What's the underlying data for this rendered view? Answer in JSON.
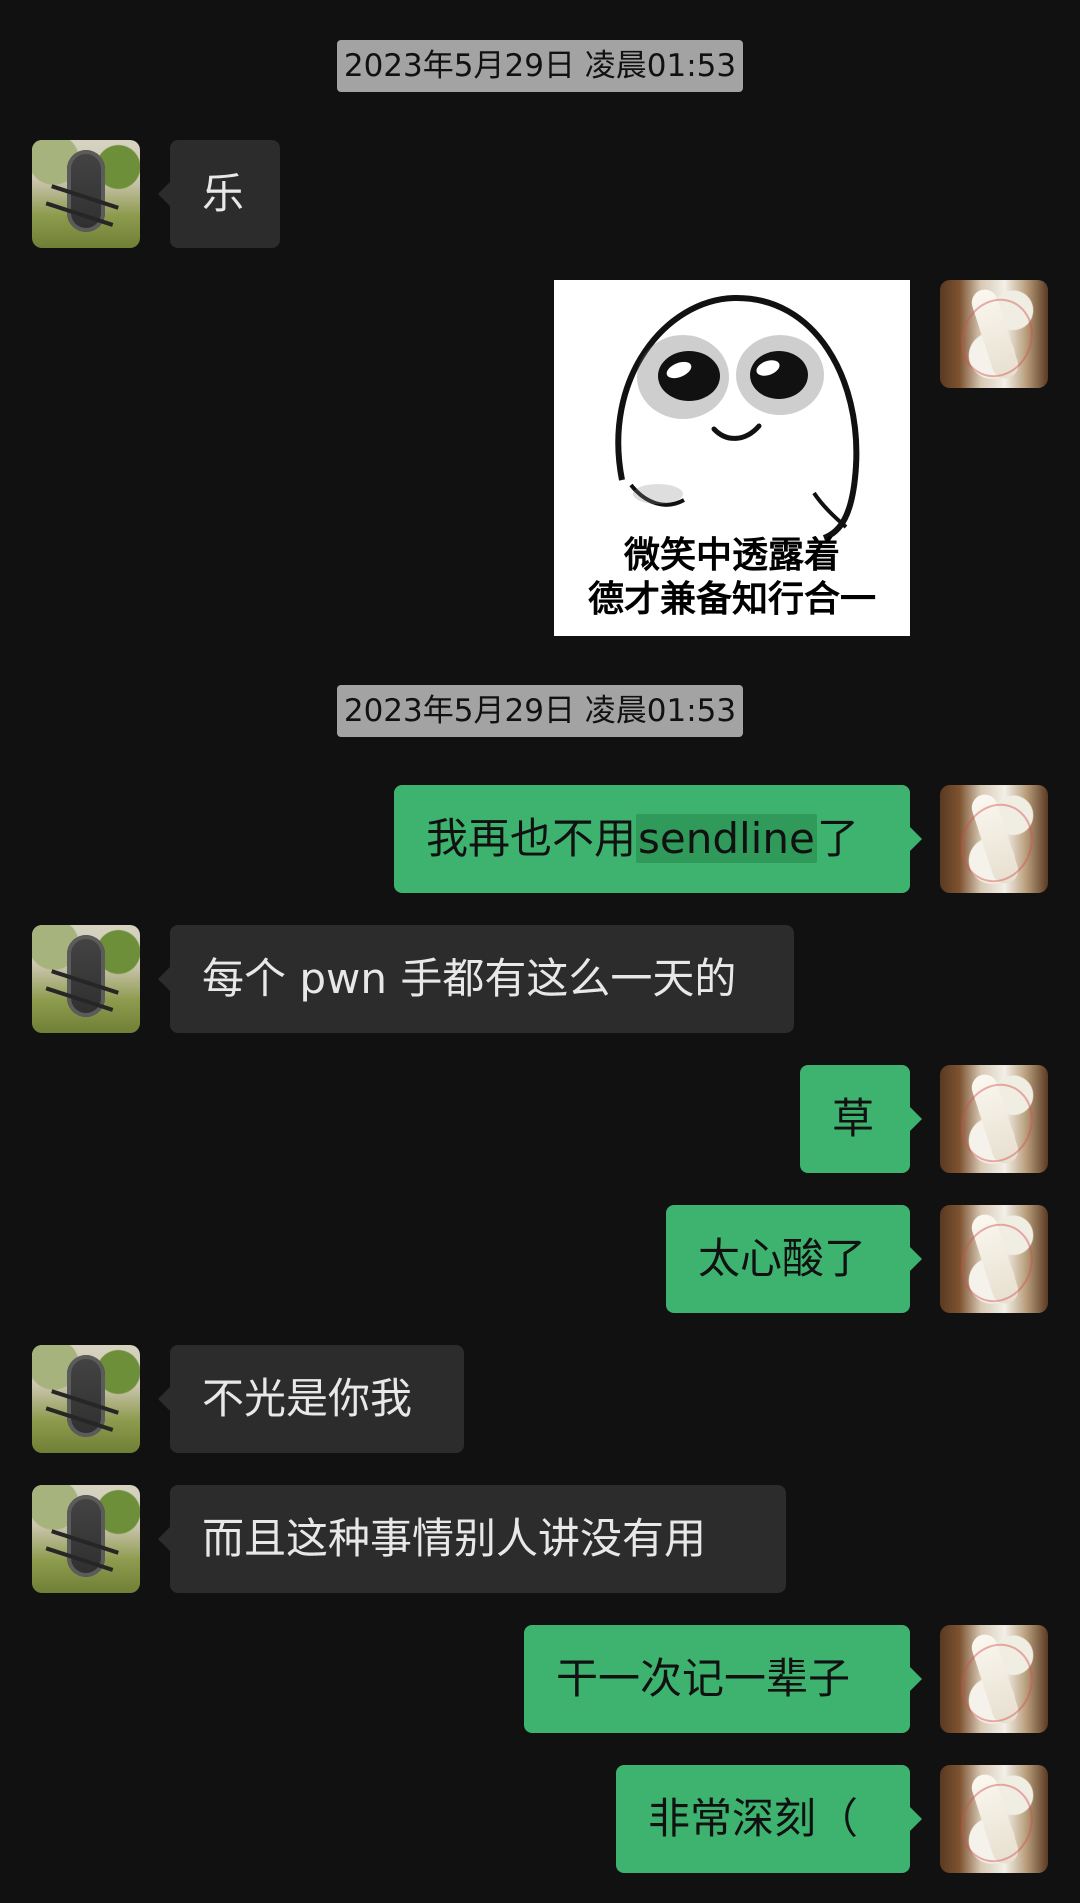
{
  "timestamps": [
    "2023年5月29日 凌晨01:53",
    "2023年5月29日 凌晨01:53"
  ],
  "sticker": {
    "caption_line_1": "微笑中透露着",
    "caption_line_2": "德才兼备知行合一"
  },
  "messages": [
    {
      "side": "left",
      "text": "乐"
    },
    {
      "side": "right",
      "text_prefix": "我再也不用",
      "highlight": "sendline",
      "text_suffix": "了"
    },
    {
      "side": "left",
      "text": "每个 pwn 手都有这么一天的"
    },
    {
      "side": "right",
      "text": "草"
    },
    {
      "side": "right",
      "text": "太心酸了"
    },
    {
      "side": "left",
      "text": "不光是你我"
    },
    {
      "side": "left",
      "text": "而且这种事情别人讲没有用"
    },
    {
      "side": "right",
      "text": "干一次记一辈子"
    },
    {
      "side": "right",
      "text": "非常深刻（"
    }
  ],
  "colors": {
    "background": "#111111",
    "left_bubble": "#2c2c2c",
    "right_bubble": "#3db36f",
    "timestamp_bg": "#a3a3a3",
    "highlight": "#2f9a5a"
  },
  "icons": {
    "left_avatar": "inflatable-boat-avatar-icon",
    "right_avatar": "anime-character-avatar-icon"
  }
}
